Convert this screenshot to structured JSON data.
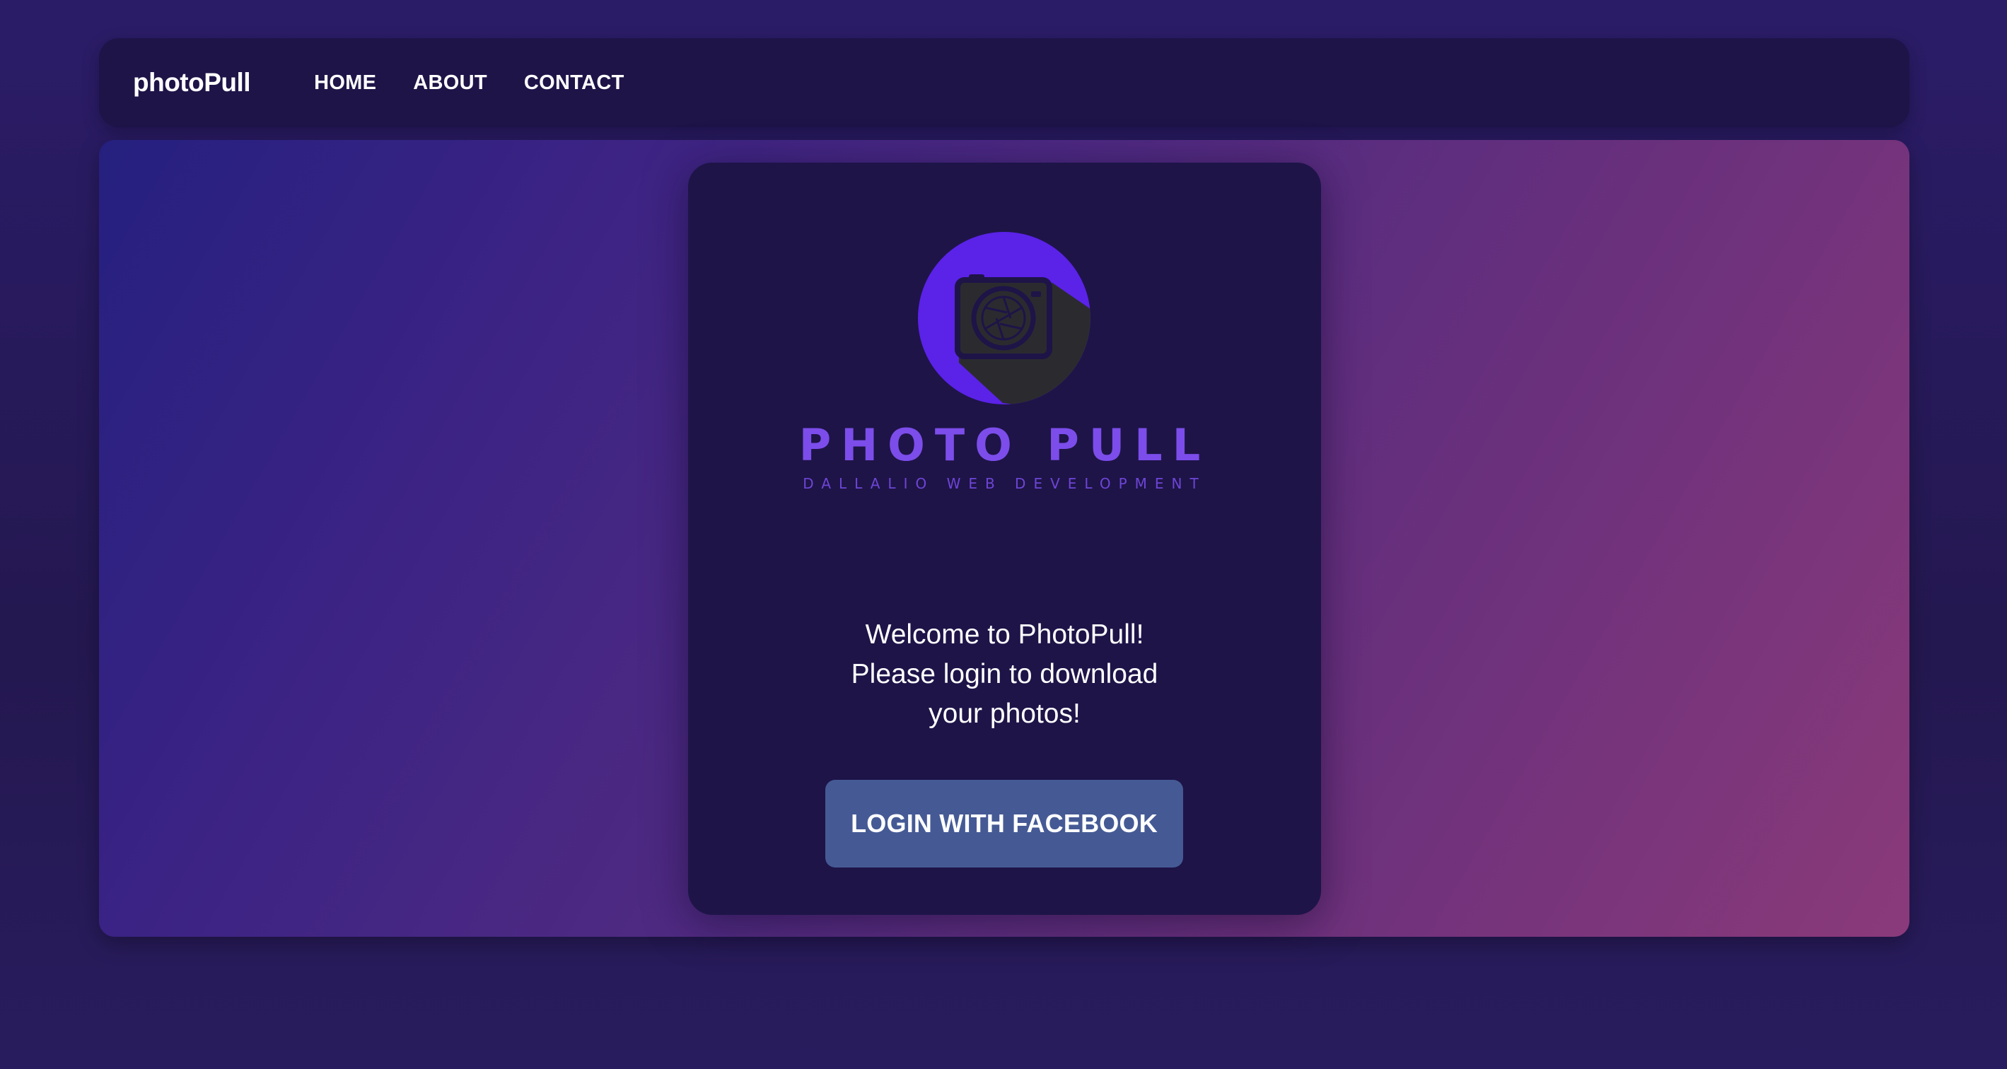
{
  "navbar": {
    "brand": "photoPull",
    "links": [
      {
        "label": "HOME"
      },
      {
        "label": "ABOUT"
      },
      {
        "label": "CONTACT"
      }
    ]
  },
  "card": {
    "logo": {
      "icon": "camera-icon",
      "title": "PHOTO PULL",
      "subtitle": "DALLALIO WEB DEVELOPMENT"
    },
    "welcome_lines": [
      "Welcome to PhotoPull!",
      "Please login to download",
      "your photos!"
    ],
    "login_button_label": "LOGIN WITH FACEBOOK"
  },
  "colors": {
    "page_background": "#271b5c",
    "navbar_background": "#1e1448",
    "card_background": "#1e1448",
    "logo_purple": "#5b22e8",
    "logo_text": "#7c4dea",
    "login_button": "#455a95",
    "hero_gradient_start": "#25207f",
    "hero_gradient_end": "#8a3a7a"
  }
}
